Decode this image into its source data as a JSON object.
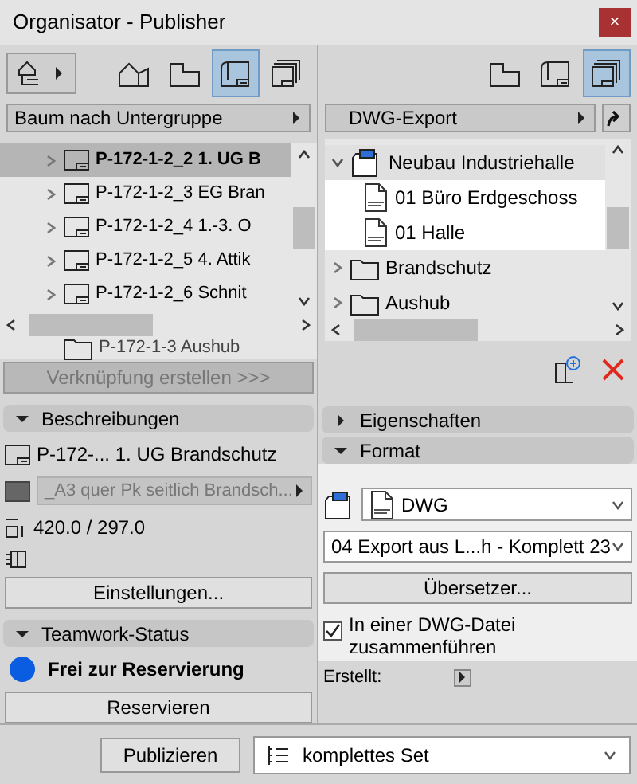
{
  "window": {
    "title": "Organisator - Publisher",
    "close": "×"
  },
  "left": {
    "view_dropdown": "Baum nach Untergruppe",
    "tree": [
      {
        "label": "P-172-1-2_2 1. UG B",
        "selected": true
      },
      {
        "label": "P-172-1-2_3 EG Bran",
        "selected": false
      },
      {
        "label": "P-172-1-2_4 1.-3. O",
        "selected": false
      },
      {
        "label": "P-172-1-2_5 4. Attik",
        "selected": false
      },
      {
        "label": "P-172-1-2_6 Schnit",
        "selected": false
      }
    ],
    "partial_row": "P-172-1-3 Aushub",
    "link_button": {
      "label": "Verknüpfung erstellen >>>",
      "disabled": true
    },
    "descriptions": {
      "header": "Beschreibungen",
      "expanded": true,
      "name": "P-172-... 1. UG Brandschutz",
      "layout": "_A3 quer Pk seitlich Brandsch...",
      "size": "420.0 / 297.0",
      "settings_button": "Einstellungen..."
    },
    "teamwork": {
      "header": "Teamwork-Status",
      "expanded": true,
      "status": "Frei zur Reservierung",
      "color": "#0a5ce0",
      "button": "Reservieren"
    }
  },
  "right": {
    "set_dropdown": "DWG-Export",
    "tree": [
      {
        "label": "Neubau Industriehalle",
        "kind": "set",
        "expanded": true,
        "children": [
          {
            "label": "01 Büro Erdgeschoss",
            "kind": "file"
          },
          {
            "label": "01 Halle",
            "kind": "file"
          }
        ]
      },
      {
        "label": "Brandschutz",
        "kind": "folder",
        "expanded": false
      },
      {
        "label": "Aushub",
        "kind": "folder",
        "expanded": false
      }
    ],
    "properties": {
      "header": "Eigenschaften",
      "expanded": false
    },
    "format": {
      "header": "Format",
      "expanded": true,
      "type": "DWG",
      "translator_setting": "04 Export aus L...h - Komplett 23",
      "translator_button": "Übersetzer...",
      "merge": {
        "label": "In einer DWG-Datei zusammenführen",
        "checked": true
      },
      "created_label": "Erstellt:"
    }
  },
  "bottom": {
    "publish_button": "Publizieren",
    "set_dropdown": "komplettes Set"
  }
}
